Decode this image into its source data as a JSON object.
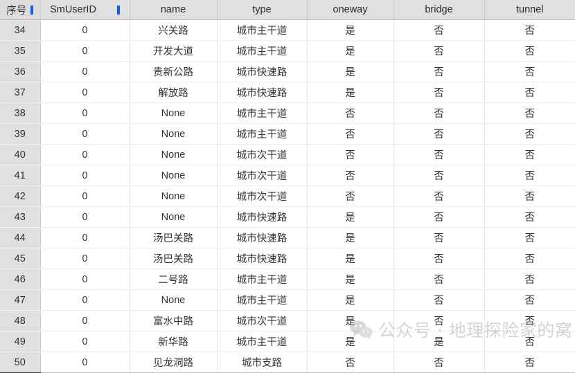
{
  "table": {
    "columns": [
      {
        "key": "idx",
        "label": "序号",
        "marker": true,
        "width": 58,
        "cjk": true
      },
      {
        "key": "smuserid",
        "label": "SmUserID",
        "marker": true,
        "width": 129,
        "cjk": false
      },
      {
        "key": "name",
        "label": "name",
        "marker": false,
        "width": 126,
        "cjk": false
      },
      {
        "key": "type",
        "label": "type",
        "marker": false,
        "width": 130,
        "cjk": false
      },
      {
        "key": "oneway",
        "label": "oneway",
        "marker": false,
        "width": 125,
        "cjk": false
      },
      {
        "key": "bridge",
        "label": "bridge",
        "marker": false,
        "width": 131,
        "cjk": false
      },
      {
        "key": "tunnel",
        "label": "tunnel",
        "marker": false,
        "width": 131,
        "cjk": false
      }
    ],
    "rows": [
      {
        "idx": "34",
        "smuserid": "0",
        "name": "兴关路",
        "type": "城市主干道",
        "oneway": "是",
        "bridge": "否",
        "tunnel": "否"
      },
      {
        "idx": "35",
        "smuserid": "0",
        "name": "开发大道",
        "type": "城市主干道",
        "oneway": "是",
        "bridge": "否",
        "tunnel": "否"
      },
      {
        "idx": "36",
        "smuserid": "0",
        "name": "贵新公路",
        "type": "城市快速路",
        "oneway": "是",
        "bridge": "否",
        "tunnel": "否"
      },
      {
        "idx": "37",
        "smuserid": "0",
        "name": "解放路",
        "type": "城市快速路",
        "oneway": "是",
        "bridge": "否",
        "tunnel": "否"
      },
      {
        "idx": "38",
        "smuserid": "0",
        "name": "None",
        "type": "城市主干道",
        "oneway": "否",
        "bridge": "否",
        "tunnel": "否"
      },
      {
        "idx": "39",
        "smuserid": "0",
        "name": "None",
        "type": "城市主干道",
        "oneway": "否",
        "bridge": "否",
        "tunnel": "否"
      },
      {
        "idx": "40",
        "smuserid": "0",
        "name": "None",
        "type": "城市次干道",
        "oneway": "否",
        "bridge": "否",
        "tunnel": "否"
      },
      {
        "idx": "41",
        "smuserid": "0",
        "name": "None",
        "type": "城市次干道",
        "oneway": "否",
        "bridge": "否",
        "tunnel": "否"
      },
      {
        "idx": "42",
        "smuserid": "0",
        "name": "None",
        "type": "城市次干道",
        "oneway": "否",
        "bridge": "否",
        "tunnel": "否"
      },
      {
        "idx": "43",
        "smuserid": "0",
        "name": "None",
        "type": "城市快速路",
        "oneway": "是",
        "bridge": "否",
        "tunnel": "否"
      },
      {
        "idx": "44",
        "smuserid": "0",
        "name": "汤巴关路",
        "type": "城市快速路",
        "oneway": "是",
        "bridge": "否",
        "tunnel": "否"
      },
      {
        "idx": "45",
        "smuserid": "0",
        "name": "汤巴关路",
        "type": "城市快速路",
        "oneway": "是",
        "bridge": "否",
        "tunnel": "否"
      },
      {
        "idx": "46",
        "smuserid": "0",
        "name": "二号路",
        "type": "城市主干道",
        "oneway": "是",
        "bridge": "否",
        "tunnel": "否"
      },
      {
        "idx": "47",
        "smuserid": "0",
        "name": "None",
        "type": "城市主干道",
        "oneway": "是",
        "bridge": "否",
        "tunnel": "否"
      },
      {
        "idx": "48",
        "smuserid": "0",
        "name": "富水中路",
        "type": "城市次干道",
        "oneway": "是",
        "bridge": "否",
        "tunnel": "否"
      },
      {
        "idx": "49",
        "smuserid": "0",
        "name": "新华路",
        "type": "城市主干道",
        "oneway": "是",
        "bridge": "是",
        "tunnel": "否"
      },
      {
        "idx": "50",
        "smuserid": "0",
        "name": "见龙洞路",
        "type": "城市支路",
        "oneway": "否",
        "bridge": "否",
        "tunnel": "否"
      }
    ]
  },
  "watermark": {
    "icon": "wechat-logo-icon",
    "text": "公众号 · 地理探险家的窝",
    "color": "#9a9a9a"
  },
  "colors": {
    "header_bg": "#e0e0e0",
    "index_col_bg": "#e0e0e0",
    "cell_bg": "#ffffff",
    "grid_line": "#e6e6e6",
    "resize_marker": "#1a56f0",
    "text": "#333333"
  }
}
